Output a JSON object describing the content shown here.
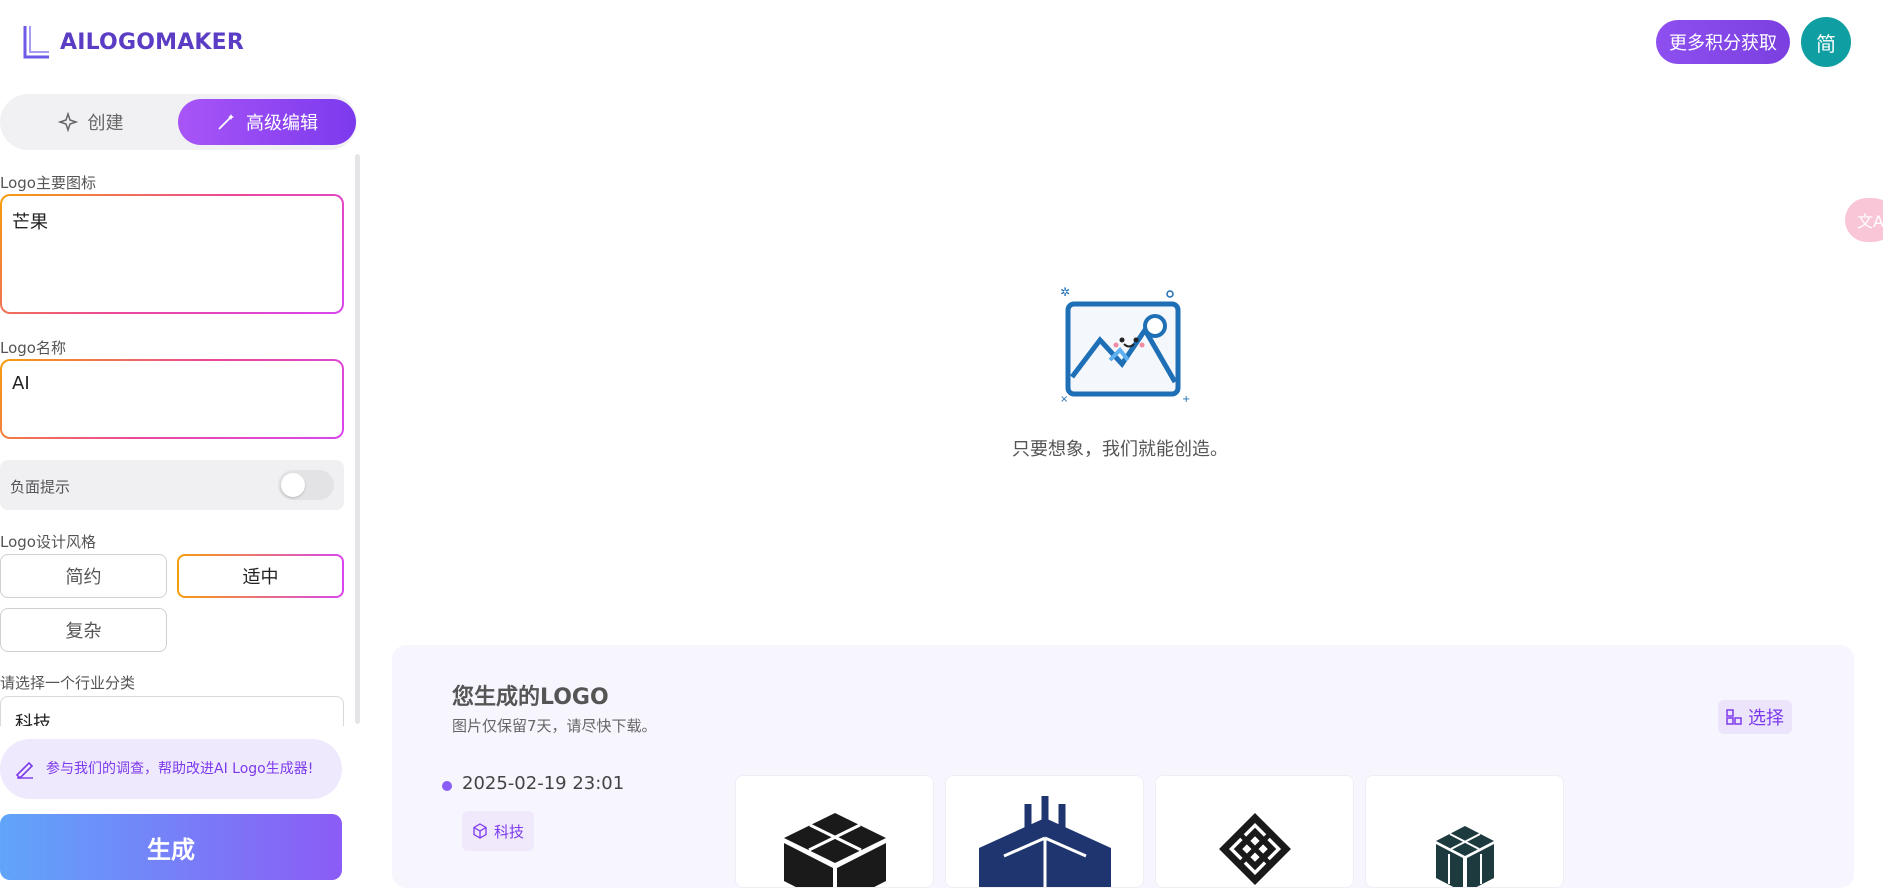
{
  "header": {
    "logo_text": "AILOGOMAKER",
    "points_button": "更多积分获取",
    "language": "简"
  },
  "sidebar": {
    "tabs": [
      {
        "label": "创建",
        "icon": "sparkle-icon"
      },
      {
        "label": "高级编辑",
        "icon": "magic-wand-icon"
      }
    ],
    "icon_field": {
      "label": "Logo主要图标",
      "value": "芒果"
    },
    "name_field": {
      "label": "Logo名称",
      "value": "AI"
    },
    "negative_prompt": {
      "label": "负面提示",
      "enabled": false
    },
    "style": {
      "label": "Logo设计风格",
      "options": [
        "简约",
        "适中",
        "复杂"
      ],
      "selected": "适中"
    },
    "industry": {
      "label": "请选择一个行业分类",
      "value": "科技"
    },
    "survey_text": "参与我们的调查，帮助改进AI Logo生成器!",
    "generate_button": "生成"
  },
  "main": {
    "empty_text": "只要想象，我们就能创造。"
  },
  "gallery": {
    "title": "您生成的LOGO",
    "subtitle": "图片仅保留7天，请尽快下载。",
    "select_button": "选择",
    "entries": [
      {
        "date": "2025-02-19 23:01",
        "tag": "科技",
        "thumbnails": [
          "cube-logo-black",
          "cube-logo-navy",
          "knot-logo-black",
          "cube-logo-teal"
        ]
      }
    ]
  },
  "colors": {
    "accent": "#7c3aed",
    "avatar": "#0f9ea1",
    "gallery_bg": "#f7f5fd"
  }
}
